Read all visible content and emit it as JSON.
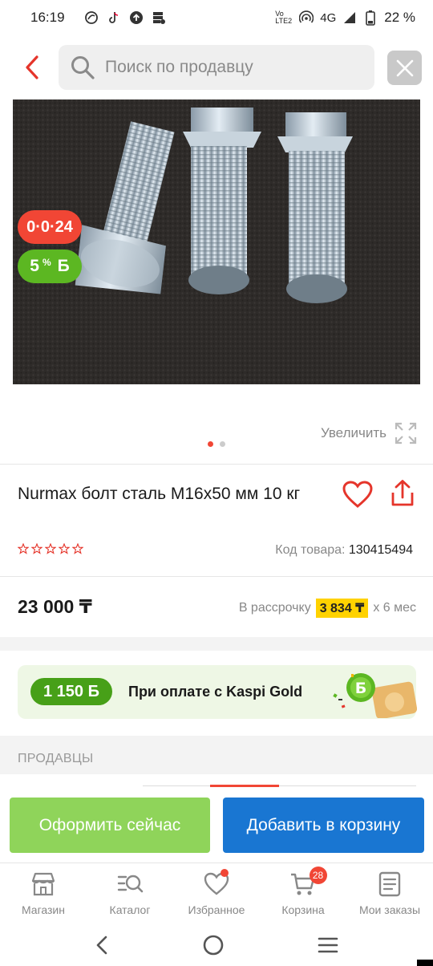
{
  "status_bar": {
    "time": "16:19",
    "network": "4G",
    "volte": "Vo LTE2",
    "battery": "22 %",
    "icons": [
      "sync-icon",
      "tiktok-icon",
      "upload-icon",
      "database-icon",
      "hotspot-icon",
      "signal-icon",
      "battery-icon"
    ]
  },
  "search": {
    "placeholder": "Поиск по продавцу"
  },
  "badges": {
    "installment": "0·0·24",
    "bonus_percent": "5",
    "bonus_percent_sign": "%",
    "bonus_symbol": "Б"
  },
  "gallery": {
    "zoom_label": "Увеличить",
    "total_images": 2,
    "active_index": 0
  },
  "product": {
    "title": "Nurmax болт сталь М16х50 мм 10 кг",
    "rating": 0,
    "max_rating": 5,
    "code_label": "Код товара:",
    "code_value": "130415494",
    "price": "23 000 ₸",
    "installment_prefix": "В рассрочку",
    "installment_amount": "3 834 ₸",
    "installment_suffix": "х 6 мес"
  },
  "kaspi_gold": {
    "bonus": "1 150 Б",
    "text": "При оплате с Kaspi Gold"
  },
  "sellers": {
    "label": "ПРОДАВЦЫ"
  },
  "actions": {
    "order_now": "Оформить сейчас",
    "add_to_cart": "Добавить в корзину"
  },
  "bottom_nav": [
    {
      "label": "Магазин",
      "icon": "store-icon"
    },
    {
      "label": "Каталог",
      "icon": "catalog-icon"
    },
    {
      "label": "Избранное",
      "icon": "heart-icon"
    },
    {
      "label": "Корзина",
      "icon": "cart-icon",
      "badge": "28"
    },
    {
      "label": "Мои заказы",
      "icon": "orders-icon"
    }
  ],
  "colors": {
    "accent_red": "#f14635",
    "bonus_green": "#5cb722",
    "order_button": "#8fd45a",
    "cart_button": "#1976d2",
    "installment_highlight": "#ffd200"
  }
}
